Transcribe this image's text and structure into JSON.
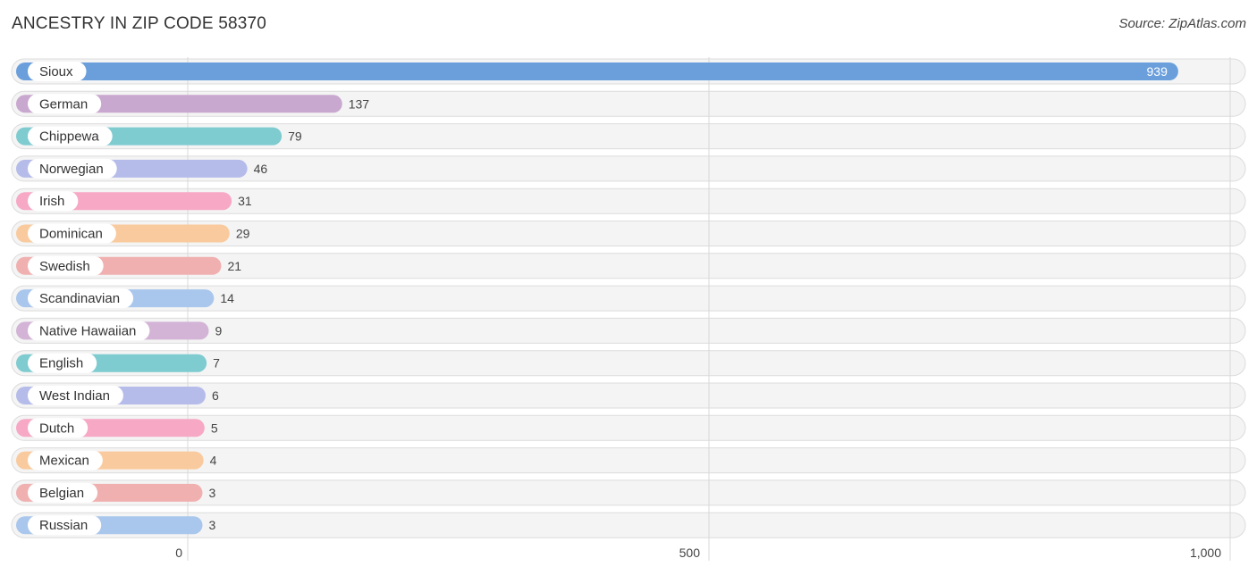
{
  "chart_data": {
    "type": "bar",
    "orientation": "horizontal",
    "title": "ANCESTRY IN ZIP CODE 58370",
    "source": "Source: ZipAtlas.com",
    "xlabel": "",
    "ylabel": "",
    "xlim": [
      0,
      1000
    ],
    "xticks": [
      0,
      500,
      1000
    ],
    "xtick_labels": [
      "0",
      "500",
      "1,000"
    ],
    "grid": true,
    "categories": [
      "Sioux",
      "German",
      "Chippewa",
      "Norwegian",
      "Irish",
      "Dominican",
      "Swedish",
      "Scandinavian",
      "Native Hawaiian",
      "English",
      "West Indian",
      "Dutch",
      "Mexican",
      "Belgian",
      "Russian"
    ],
    "values": [
      939,
      137,
      79,
      46,
      31,
      29,
      21,
      14,
      9,
      7,
      6,
      5,
      4,
      3,
      3
    ],
    "value_labels": [
      "939",
      "137",
      "79",
      "46",
      "31",
      "29",
      "21",
      "14",
      "9",
      "7",
      "6",
      "5",
      "4",
      "3",
      "3"
    ],
    "colors": [
      "#6a9fdc",
      "#c9a8cf",
      "#7ecbd0",
      "#b5bcea",
      "#f6a8c4",
      "#f9ca9e",
      "#f0b0b0",
      "#a9c6ec",
      "#d3b4d6",
      "#7ecbd0",
      "#b5bcea",
      "#f6a8c4",
      "#f9ca9e",
      "#f0b0b0",
      "#a9c6ec"
    ]
  }
}
